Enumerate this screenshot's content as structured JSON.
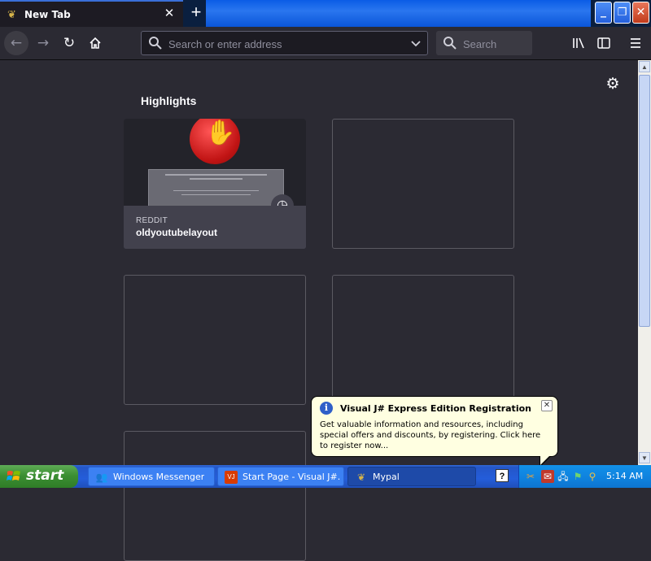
{
  "browser": {
    "tab": {
      "title": "New Tab",
      "close_icon": "close-icon",
      "icon": "mypal-icon"
    },
    "new_tab_icon": "plus-icon",
    "window_controls": {
      "minimize": "minimize-icon",
      "maximize": "restore-icon",
      "close": "close-icon"
    }
  },
  "toolbar": {
    "back_icon": "back-arrow-icon",
    "forward_icon": "forward-arrow-icon",
    "reload_icon": "reload-icon",
    "home_icon": "home-icon",
    "address_placeholder": "Search or enter address",
    "address_value": "",
    "search_placeholder": "Search",
    "library_icon": "library-icon",
    "sidebar_icon": "sidebar-icon",
    "menu_icon": "hamburger-menu-icon"
  },
  "newtab": {
    "settings_icon": "gear-icon",
    "highlights_title": "Highlights",
    "cards": [
      {
        "source": "REDDIT",
        "title": "oldyoutubelayout",
        "badge_icon": "clock-icon"
      }
    ]
  },
  "balloon": {
    "title": "Visual J# Express Edition Registration",
    "text": "Get valuable information and resources, including special offers and discounts, by registering. Click here to register now...",
    "icon": "info-icon"
  },
  "taskbar": {
    "start_label": "start",
    "tasks": [
      {
        "label": "Windows Messenger",
        "icon": "messenger-icon"
      },
      {
        "label": "Start Page - Visual J#...",
        "icon": "visual-studio-icon"
      },
      {
        "label": "Mypal",
        "icon": "mypal-icon"
      }
    ],
    "help_label": "?",
    "clock": "5:14 AM"
  },
  "colors": {
    "page_background": "#2b2a33",
    "card_background": "#42414d",
    "xp_taskbar": "#245dda",
    "xp_start": "#3c8f33",
    "balloon_background": "#ffffe1"
  }
}
